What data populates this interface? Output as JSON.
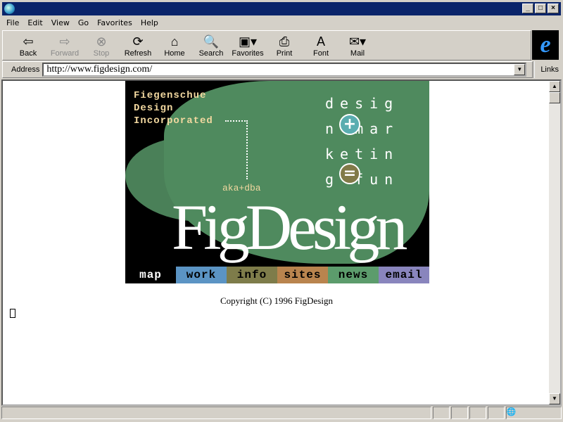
{
  "menu": [
    "File",
    "Edit",
    "View",
    "Go",
    "Favorites",
    "Help"
  ],
  "toolbar": [
    {
      "label": "Back",
      "icon": "back-arrow-icon",
      "glyph": "⇦",
      "enabled": true
    },
    {
      "label": "Forward",
      "icon": "forward-arrow-icon",
      "glyph": "⇨",
      "enabled": false
    },
    {
      "label": "Stop",
      "icon": "stop-icon",
      "glyph": "⊗",
      "enabled": false
    },
    {
      "label": "Refresh",
      "icon": "refresh-icon",
      "glyph": "⟳",
      "enabled": true
    },
    {
      "label": "Home",
      "icon": "home-icon",
      "glyph": "⌂",
      "enabled": true
    },
    {
      "label": "Search",
      "icon": "search-icon",
      "glyph": "🔍",
      "enabled": true
    },
    {
      "label": "Favorites",
      "icon": "favorites-folder-icon",
      "glyph": "▣▾",
      "enabled": true
    },
    {
      "label": "Print",
      "icon": "print-icon",
      "glyph": "⎙",
      "enabled": true
    },
    {
      "label": "Font",
      "icon": "font-icon",
      "glyph": "A",
      "enabled": true
    },
    {
      "label": "Mail",
      "icon": "mail-icon",
      "glyph": "✉▾",
      "enabled": true
    }
  ],
  "address": {
    "label": "Address",
    "value": "http://www.figdesign.com/"
  },
  "links_label": "Links",
  "banner": {
    "company": [
      "Fiegenschue",
      "Design",
      "Incorporated"
    ],
    "aka": "aka+dba",
    "slogan": "desig\nn mar\nketin\ng fun",
    "plus": "+",
    "equals": "=",
    "logo": "FigDesign",
    "nav": [
      {
        "label": "map",
        "color": "#000000",
        "text": "#ffffff"
      },
      {
        "label": "work",
        "color": "#5b94c4",
        "text": "#000000"
      },
      {
        "label": "info",
        "color": "#7e7c4a",
        "text": "#000000"
      },
      {
        "label": "sites",
        "color": "#b9844e",
        "text": "#000000"
      },
      {
        "label": "news",
        "color": "#5c9c6c",
        "text": "#000000"
      },
      {
        "label": "email",
        "color": "#8985bd",
        "text": "#000000"
      }
    ]
  },
  "copyright": "Copyright (C) 1996 FigDesign"
}
